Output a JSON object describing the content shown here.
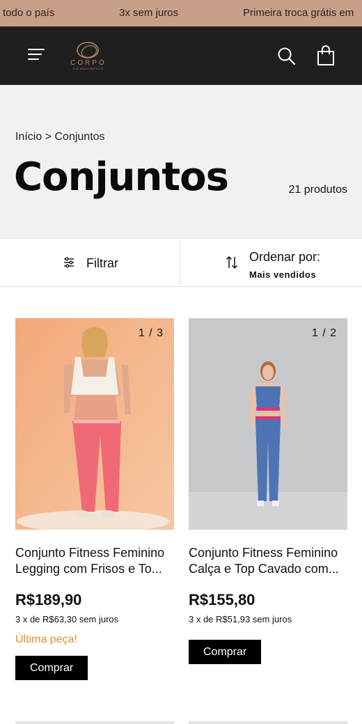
{
  "announcement": {
    "items": [
      "todo o país",
      "3x sem juros",
      "Primeira troca grátis em"
    ]
  },
  "header": {
    "logo_text": "CORPO",
    "logo_subtext": "EM MOVIMENTO"
  },
  "breadcrumb": {
    "home": "Início",
    "separator": ">",
    "current": "Conjuntos"
  },
  "page": {
    "title": "Conjuntos",
    "count": "21 produtos"
  },
  "filters": {
    "filter_label": "Filtrar",
    "sort_label": "Ordenar por:",
    "sort_value": "Mais vendidos"
  },
  "products": [
    {
      "counter": "1 / 3",
      "name": "Conjunto Fitness Feminino Legging com Frisos e To...",
      "price": "R$189,90",
      "installments": "3 x de R$63,30 sem juros",
      "stock_note": "Última peça!",
      "buy_label": "Comprar"
    },
    {
      "counter": "1 / 2",
      "name": "Conjunto Fitness Feminino Calça e Top Cavado com...",
      "price": "R$155,80",
      "installments": "3 x de R$51,93 sem juros",
      "buy_label": "Comprar"
    }
  ],
  "colors": {
    "announcement_bg": "#c8a08a",
    "header_bg": "#1f1f1f",
    "stock_note": "#e0902b",
    "button_bg": "#000000"
  }
}
